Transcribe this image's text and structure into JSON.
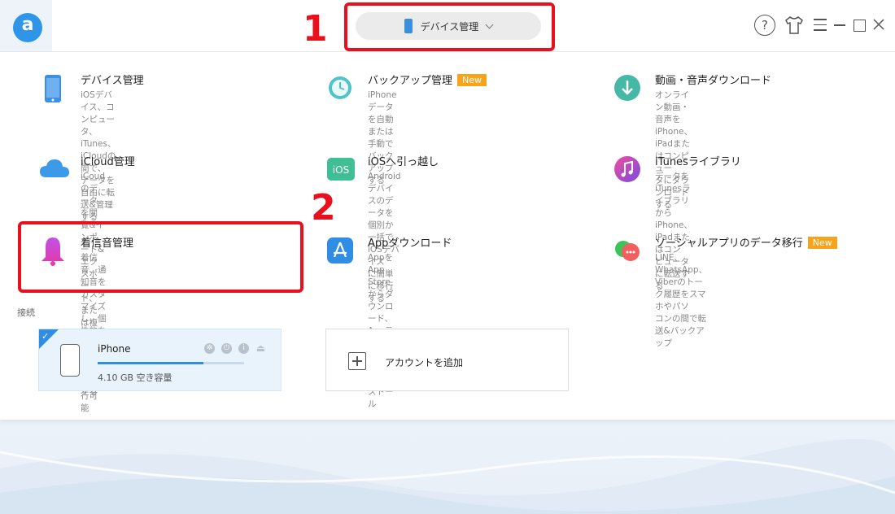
{
  "header": {
    "logo_letter": "a",
    "device_dropdown_label": "デバイス管理",
    "help_label": "?"
  },
  "annotations": {
    "step1": "1",
    "step2": "2"
  },
  "features": [
    {
      "title": "デバイス管理",
      "desc1": "iOSデバイス、コンピュータ、iTunes、iCloudの間で、",
      "desc2": "データを自由に転送&管理する",
      "badge": "",
      "icon": "phone-icon"
    },
    {
      "title": "バックアップ管理",
      "desc1": "iPhoneデータを自動または手動でバックアップする",
      "desc2": "",
      "badge": "New",
      "icon": "backup-clock-icon"
    },
    {
      "title": "動画・音声ダウンロード",
      "desc1": "オンライン動画・音声をiPhone、iPadまたはコンピュー",
      "desc2": "タにダウンロードする",
      "badge": "",
      "icon": "download-arrow-icon"
    },
    {
      "title": "iCloud管理",
      "desc1": "iCoudのデータを閲覧&インポート&エクスポート、また",
      "desc2": "は複数のアカウント間で移行可能",
      "badge": "",
      "icon": "cloud-icon"
    },
    {
      "title": "iOSへ引っ越し",
      "desc1": "Androidデバイスのデータを個別か一括でiOSデバイス",
      "desc2": "に簡単に移行する",
      "badge": "",
      "icon": "move-to-ios-icon"
    },
    {
      "title": "iTunesライブラリ",
      "desc1": "データをiTunesライブラリからiPhone、iPadまたはコン",
      "desc2": "ピュータに転送する",
      "badge": "",
      "icon": "music-note-icon"
    },
    {
      "title": "着信音管理",
      "desc1": "着信音、通知音をカスタマイズし、個性的な着信音を",
      "desc2": "iPhoneに同期する",
      "badge": "",
      "icon": "bell-icon"
    },
    {
      "title": "Appダウンロード",
      "desc1": "AppをApp Storeからダウンロード、Appライブラリから",
      "desc2": "iPhoneにインストール",
      "badge": "",
      "icon": "app-store-icon"
    },
    {
      "title": "ソーシャルアプリのデータ移行",
      "desc1": "LINE、WhatsApp、Viberのトーク履歴をスマホやパソ",
      "desc2": "コンの間で転送&バックアップ",
      "badge": "New",
      "icon": "chat-bubbles-icon"
    }
  ],
  "connection": {
    "section_label": "接続",
    "device_name": "iPhone",
    "storage_text": "4.10 GB 空き容量",
    "storage_used_fraction": 0.72,
    "add_account_label": "アカウントを追加"
  },
  "colors": {
    "accent": "#2f8de4",
    "new_badge": "#f7a31b",
    "annotation_red": "#e8101c"
  }
}
